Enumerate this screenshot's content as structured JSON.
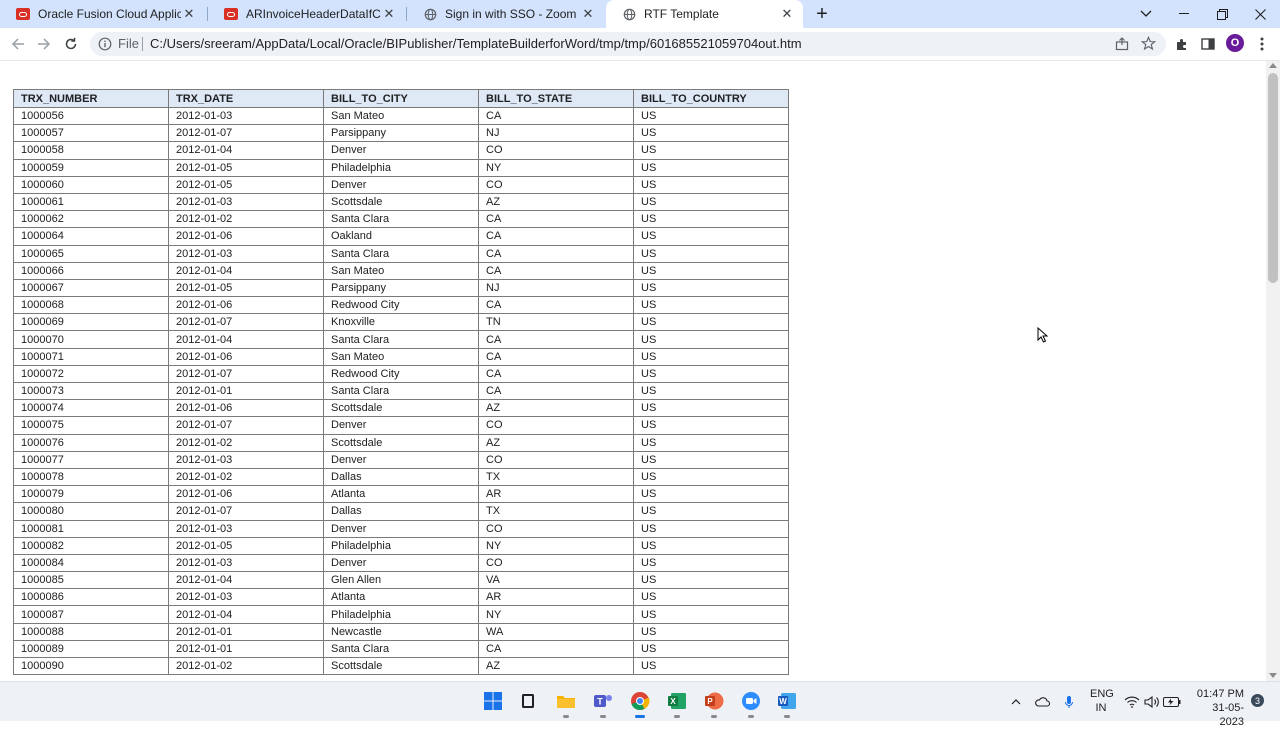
{
  "browser": {
    "tabs": [
      {
        "title": "Oracle Fusion Cloud Applications",
        "favicon": "oracle-icon"
      },
      {
        "title": "ARInvoiceHeaderDataIfChooseD",
        "favicon": "oracle-icon"
      },
      {
        "title": "Sign in with SSO - Zoom",
        "favicon": "globe-icon"
      },
      {
        "title": "RTF Template",
        "favicon": "globe-icon"
      }
    ],
    "active_tab": 3,
    "address": {
      "scheme_label": "File",
      "url": "C:/Users/sreeram/AppData/Local/Oracle/BIPublisher/TemplateBuilderforWord/tmp/tmp/601685521059704out.htm"
    },
    "profile_initial": "O"
  },
  "report": {
    "columns": [
      "TRX_NUMBER",
      "TRX_DATE",
      "BILL_TO_CITY",
      "BILL_TO_STATE",
      "BILL_TO_COUNTRY"
    ],
    "rows": [
      [
        "1000056",
        "2012-01-03",
        "San Mateo",
        "CA",
        "US"
      ],
      [
        "1000057",
        "2012-01-07",
        "Parsippany",
        "NJ",
        "US"
      ],
      [
        "1000058",
        "2012-01-04",
        "Denver",
        "CO",
        "US"
      ],
      [
        "1000059",
        "2012-01-05",
        "Philadelphia",
        "NY",
        "US"
      ],
      [
        "1000060",
        "2012-01-05",
        "Denver",
        "CO",
        "US"
      ],
      [
        "1000061",
        "2012-01-03",
        "Scottsdale",
        "AZ",
        "US"
      ],
      [
        "1000062",
        "2012-01-02",
        "Santa Clara",
        "CA",
        "US"
      ],
      [
        "1000064",
        "2012-01-06",
        "Oakland",
        "CA",
        "US"
      ],
      [
        "1000065",
        "2012-01-03",
        "Santa Clara",
        "CA",
        "US"
      ],
      [
        "1000066",
        "2012-01-04",
        "San Mateo",
        "CA",
        "US"
      ],
      [
        "1000067",
        "2012-01-05",
        "Parsippany",
        "NJ",
        "US"
      ],
      [
        "1000068",
        "2012-01-06",
        "Redwood City",
        "CA",
        "US"
      ],
      [
        "1000069",
        "2012-01-07",
        "Knoxville",
        "TN",
        "US"
      ],
      [
        "1000070",
        "2012-01-04",
        "Santa Clara",
        "CA",
        "US"
      ],
      [
        "1000071",
        "2012-01-06",
        "San Mateo",
        "CA",
        "US"
      ],
      [
        "1000072",
        "2012-01-07",
        "Redwood City",
        "CA",
        "US"
      ],
      [
        "1000073",
        "2012-01-01",
        "Santa Clara",
        "CA",
        "US"
      ],
      [
        "1000074",
        "2012-01-06",
        "Scottsdale",
        "AZ",
        "US"
      ],
      [
        "1000075",
        "2012-01-07",
        "Denver",
        "CO",
        "US"
      ],
      [
        "1000076",
        "2012-01-02",
        "Scottsdale",
        "AZ",
        "US"
      ],
      [
        "1000077",
        "2012-01-03",
        "Denver",
        "CO",
        "US"
      ],
      [
        "1000078",
        "2012-01-02",
        "Dallas",
        "TX",
        "US"
      ],
      [
        "1000079",
        "2012-01-06",
        "Atlanta",
        "AR",
        "US"
      ],
      [
        "1000080",
        "2012-01-07",
        "Dallas",
        "TX",
        "US"
      ],
      [
        "1000081",
        "2012-01-03",
        "Denver",
        "CO",
        "US"
      ],
      [
        "1000082",
        "2012-01-05",
        "Philadelphia",
        "NY",
        "US"
      ],
      [
        "1000084",
        "2012-01-03",
        "Denver",
        "CO",
        "US"
      ],
      [
        "1000085",
        "2012-01-04",
        "Glen Allen",
        "VA",
        "US"
      ],
      [
        "1000086",
        "2012-01-03",
        "Atlanta",
        "AR",
        "US"
      ],
      [
        "1000087",
        "2012-01-04",
        "Philadelphia",
        "NY",
        "US"
      ],
      [
        "1000088",
        "2012-01-01",
        "Newcastle",
        "WA",
        "US"
      ],
      [
        "1000089",
        "2012-01-01",
        "Santa Clara",
        "CA",
        "US"
      ],
      [
        "1000090",
        "2012-01-02",
        "Scottsdale",
        "AZ",
        "US"
      ]
    ]
  },
  "taskbar": {
    "apps": [
      "windows-start-icon",
      "file-icon",
      "file-explorer-icon",
      "teams-icon",
      "chrome-icon",
      "excel-icon",
      "powerpoint-icon",
      "zoom-icon",
      "word-icon"
    ],
    "language_top": "ENG",
    "language_bottom": "IN",
    "time": "01:47 PM",
    "date": "31-05-2023",
    "notification_count": "3"
  },
  "colors": {
    "tabstrip_bg": "#d3e3fd",
    "header_bg": "#dfe9f6",
    "oracle_red": "#d93025",
    "profile_purple": "#6a1b9a"
  }
}
